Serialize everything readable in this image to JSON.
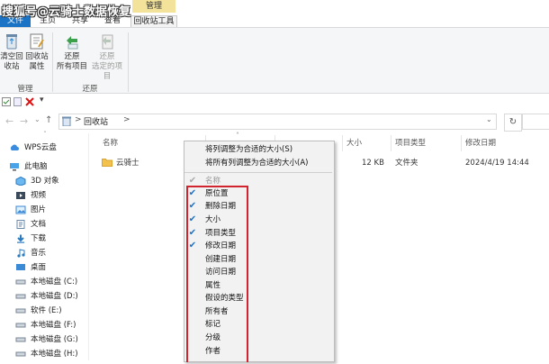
{
  "watermark": "搜狐号@云骑士数据恢复",
  "ribbon": {
    "manage_header": "管理",
    "tabs": [
      "文件",
      "主页",
      "共享",
      "查看",
      "回收站工具"
    ],
    "buttons": [
      {
        "label1": "清空回",
        "label2": "收站",
        "icon": "recycle-empty-icon"
      },
      {
        "label1": "回收站",
        "label2": "属性",
        "icon": "properties-icon"
      },
      {
        "label1": "还原",
        "label2": "所有项目",
        "icon": "restore-all-icon"
      },
      {
        "label1": "还原",
        "label2": "选定的项目",
        "icon": "restore-selected-icon"
      }
    ],
    "groups": [
      "管理",
      "还原"
    ]
  },
  "address": {
    "path_root": "回收站",
    "separator": ">"
  },
  "nav": {
    "items": [
      {
        "label": "WPS云盘",
        "icon": "cloud-icon"
      },
      {
        "label": "此电脑",
        "icon": "computer-icon"
      },
      {
        "label": "3D 对象",
        "icon": "3d-objects-icon"
      },
      {
        "label": "视频",
        "icon": "video-icon"
      },
      {
        "label": "图片",
        "icon": "pictures-icon"
      },
      {
        "label": "文档",
        "icon": "documents-icon"
      },
      {
        "label": "下载",
        "icon": "download-icon"
      },
      {
        "label": "音乐",
        "icon": "music-icon"
      },
      {
        "label": "桌面",
        "icon": "desktop-icon"
      },
      {
        "label": "本地磁盘 (C:)",
        "icon": "drive-icon"
      },
      {
        "label": "本地磁盘 (D:)",
        "icon": "drive-icon"
      },
      {
        "label": "软件 (E:)",
        "icon": "drive-icon"
      },
      {
        "label": "本地磁盘 (F:)",
        "icon": "drive-icon"
      },
      {
        "label": "本地磁盘 (G:)",
        "icon": "drive-icon"
      },
      {
        "label": "本地磁盘 (H:)",
        "icon": "drive-icon"
      }
    ]
  },
  "columns": {
    "name": "名称",
    "size": "大小",
    "type": "项目类型",
    "modified": "修改日期"
  },
  "file": {
    "name": "云骑士",
    "size": "12 KB",
    "type": "文件夹",
    "modified": "2024/4/19 14:44"
  },
  "menu": {
    "top": [
      "将列调整为合适的大小(S)",
      "将所有列调整为合适的大小(A)"
    ],
    "items": [
      {
        "label": "名称",
        "checked": "grey"
      },
      {
        "label": "原位置",
        "checked": "yes"
      },
      {
        "label": "删除日期",
        "checked": "yes"
      },
      {
        "label": "大小",
        "checked": "yes"
      },
      {
        "label": "项目类型",
        "checked": "yes"
      },
      {
        "label": "修改日期",
        "checked": "yes"
      },
      {
        "label": "创建日期",
        "checked": "no"
      },
      {
        "label": "访问日期",
        "checked": "no"
      },
      {
        "label": "属性",
        "checked": "no"
      },
      {
        "label": "假设的类型",
        "checked": "no"
      },
      {
        "label": "所有者",
        "checked": "no"
      },
      {
        "label": "标记",
        "checked": "no"
      },
      {
        "label": "分级",
        "checked": "no"
      },
      {
        "label": "作者",
        "checked": "no"
      }
    ]
  },
  "colors": {
    "accent": "#1b73c6",
    "manage_tab": "#f3e39a",
    "highlight": "#d1242e",
    "folder": "#f2c14e"
  }
}
